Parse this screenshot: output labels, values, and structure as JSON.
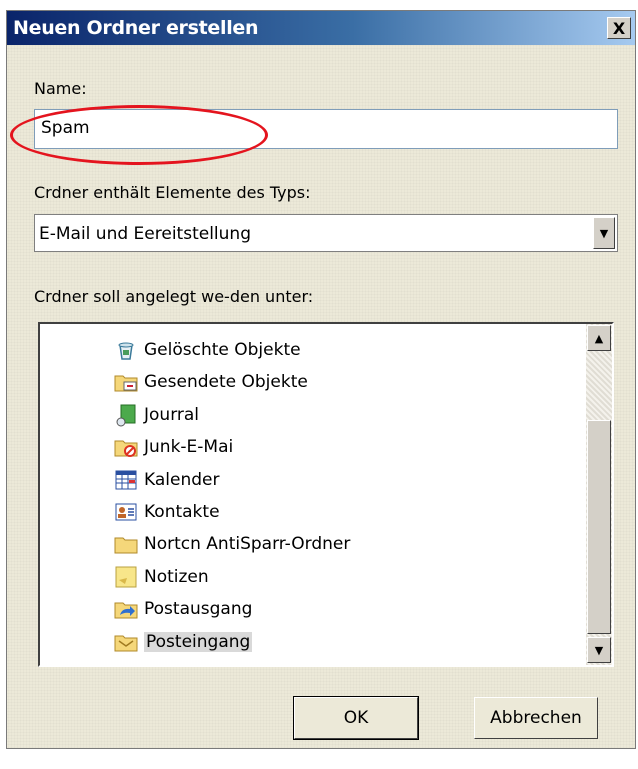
{
  "dialog": {
    "title": "Neuen Ordner erstellen",
    "close_label": "X"
  },
  "name_section": {
    "label": "Name:",
    "value": "Spam"
  },
  "type_section": {
    "label": "Crdner enthält Elemente des Typs:",
    "selected": "E-Mail und Eereitstellung"
  },
  "location_section": {
    "label": "Crdner soll angelegt we-den unter:",
    "items": [
      {
        "label": "Gelöschte Objekte",
        "icon": "trash-icon"
      },
      {
        "label": "Gesendete Objekte",
        "icon": "sent-folder-icon"
      },
      {
        "label": "Jourral",
        "icon": "journal-icon"
      },
      {
        "label": "Junk-E-Mai",
        "icon": "junk-folder-icon"
      },
      {
        "label": "Kalender",
        "icon": "calendar-icon"
      },
      {
        "label": "Kontakte",
        "icon": "contacts-icon"
      },
      {
        "label": "Nortcn AntiSparr-Ordner",
        "icon": "folder-icon"
      },
      {
        "label": "Notizen",
        "icon": "notes-icon"
      },
      {
        "label": "Postausgang",
        "icon": "outbox-icon"
      },
      {
        "label": "Posteingang",
        "icon": "inbox-icon",
        "selected": true
      }
    ]
  },
  "buttons": {
    "ok": "OK",
    "cancel": "Abbrechen"
  },
  "colors": {
    "title_start": "#0a246a",
    "title_end": "#a6caf0",
    "highlight": "#e4141e",
    "dialog_bg": "#ece9d8"
  }
}
